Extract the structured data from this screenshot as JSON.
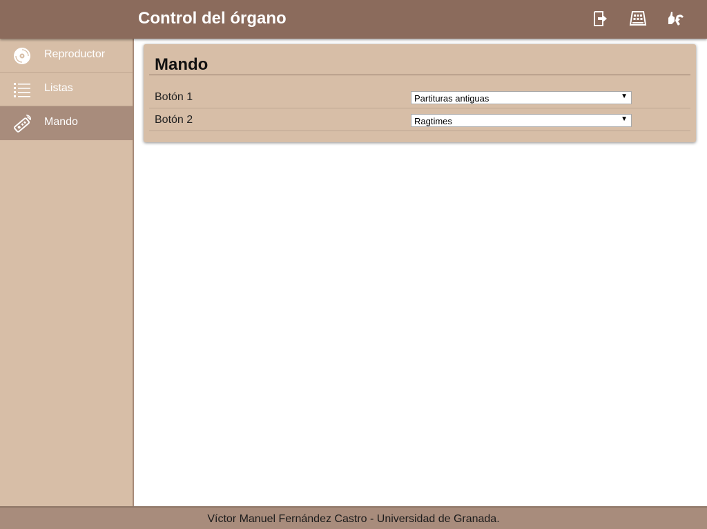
{
  "header": {
    "title": "Control del órgano",
    "actions": [
      {
        "icon": "logout-icon"
      },
      {
        "icon": "keypad-icon"
      },
      {
        "icon": "sign-language-icon"
      }
    ]
  },
  "sidebar": {
    "items": [
      {
        "label": "Reproductor",
        "icon": "disc-icon",
        "active": false
      },
      {
        "label": "Listas",
        "icon": "list-icon",
        "active": false
      },
      {
        "label": "Mando",
        "icon": "remote-icon",
        "active": true
      }
    ]
  },
  "main": {
    "panel": {
      "title": "Mando",
      "rows": [
        {
          "label": "Botón 1",
          "selected": "Partituras antiguas"
        },
        {
          "label": "Botón 2",
          "selected": "Ragtimes"
        }
      ]
    }
  },
  "footer": {
    "text": "Víctor Manuel Fernández Castro - Universidad de Granada."
  },
  "colors": {
    "header_bg": "#8b6b5c",
    "sidebar_bg": "#d7bea7",
    "active_item_bg": "#a88c7c",
    "footer_bg": "#a88c7c"
  }
}
